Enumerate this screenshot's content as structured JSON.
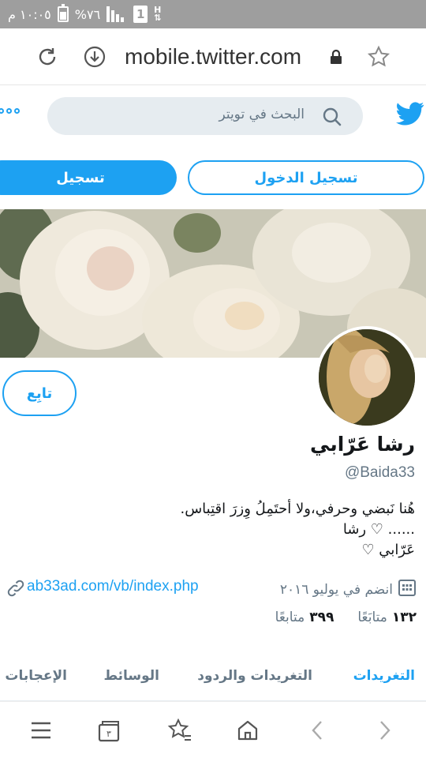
{
  "statusbar": {
    "time": "١٠:٠٥ م",
    "battery_text": "%٧٦",
    "sim_label": "1",
    "network": "H"
  },
  "browser": {
    "url": "mobile.twitter.com"
  },
  "twitter_header": {
    "search_placeholder": "البحث في تويتر"
  },
  "auth": {
    "login_label": "تسجيل الدخول",
    "signup_label": "تسجيل"
  },
  "profile": {
    "follow_label": "تابِع",
    "name": "رشا عَرّابي",
    "handle": "@Baida33",
    "bio_lines": [
      "هُنا نَبضي وحرفي،ولا أحتَمِلُ وِزرَ اقتِباس.",
      "...... ♡ رشا",
      "عَرّابي ♡"
    ],
    "joined": "انضم في يوليو ٢٠١٦",
    "link": "ab33ad.com/vb/index.php",
    "following_count": "١٣٢",
    "following_label": "متابَعًا",
    "followers_count": "٣٩٩",
    "followers_label": "متابعًا"
  },
  "tabs": [
    {
      "label": "التغريدات",
      "active": true
    },
    {
      "label": "التغريدات والردود",
      "active": false
    },
    {
      "label": "الوسائط",
      "active": false
    },
    {
      "label": "الإعجابات",
      "active": false
    }
  ],
  "colors": {
    "accent": "#1da1f2",
    "secondary_text": "#657786",
    "statusbar": "#9e9e9e"
  }
}
